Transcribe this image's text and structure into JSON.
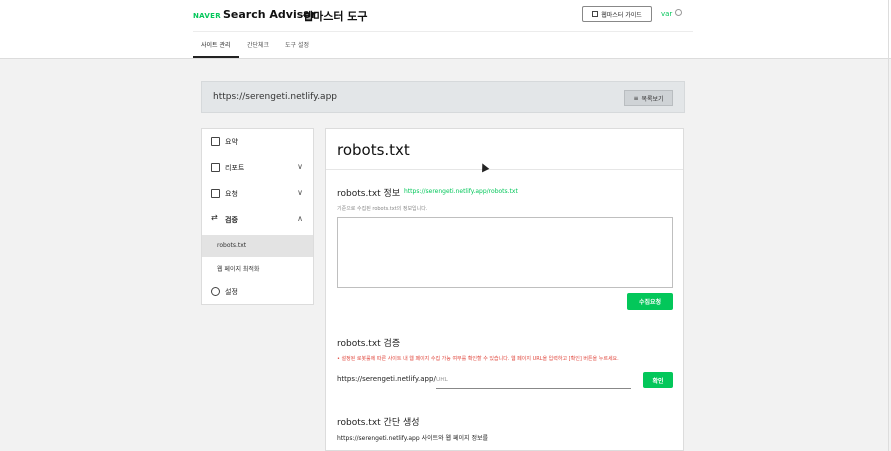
{
  "header": {
    "naver_logo": "NAVER",
    "app_title": "Search Advisor",
    "tool_title": "웹마스터 도구",
    "guide_label": "웹마스터 가이드",
    "user": "var"
  },
  "tabs": [
    {
      "label": "사이트 관리",
      "active": true
    },
    {
      "label": "간단체크",
      "active": false
    },
    {
      "label": "도구 설정",
      "active": false
    }
  ],
  "site": {
    "url": "https://serengeti.netlify.app",
    "list_button": "목록보기"
  },
  "sidebar": {
    "items": [
      {
        "label": "요약",
        "icon": "summary-icon"
      },
      {
        "label": "리포트",
        "icon": "report-icon",
        "chevron": "∨"
      },
      {
        "label": "요청",
        "icon": "request-icon",
        "chevron": "∨"
      },
      {
        "label": "검증",
        "icon": "verify-icon",
        "chevron": "∧",
        "bold": true
      },
      {
        "label": "설정",
        "icon": "gear-icon"
      }
    ],
    "sub_items": [
      {
        "label": "robots.txt",
        "active": true
      },
      {
        "label": "웹 페이지 최적화",
        "active": false
      }
    ]
  },
  "main": {
    "title": "robots.txt",
    "info": {
      "title": "robots.txt 정보",
      "link": "https://serengeti.netlify.app/robots.txt",
      "desc": "기준으로 수집된 robots.txt의 정보입니다.",
      "collect_button": "수집요청"
    },
    "verify": {
      "title": "robots.txt 검증",
      "warning": "• 설정된 로봇룰에 따른 사이트 내 웹 페이지 수집 가능 여부를 확인할 수 있습니다. 웹 페이지 URL을 입력하고 [확인] 버튼을 누르세요.",
      "url_prefix": "https://serengeti.netlify.app/",
      "url_placeholder": "URL",
      "confirm_button": "확인"
    },
    "generate": {
      "title": "robots.txt 간단 생성",
      "desc": "https://serengeti.netlify.app 사이트와 웹 페이지 정보를"
    }
  },
  "colors": {
    "accent": "#03c75a",
    "warning": "#e0463c"
  }
}
